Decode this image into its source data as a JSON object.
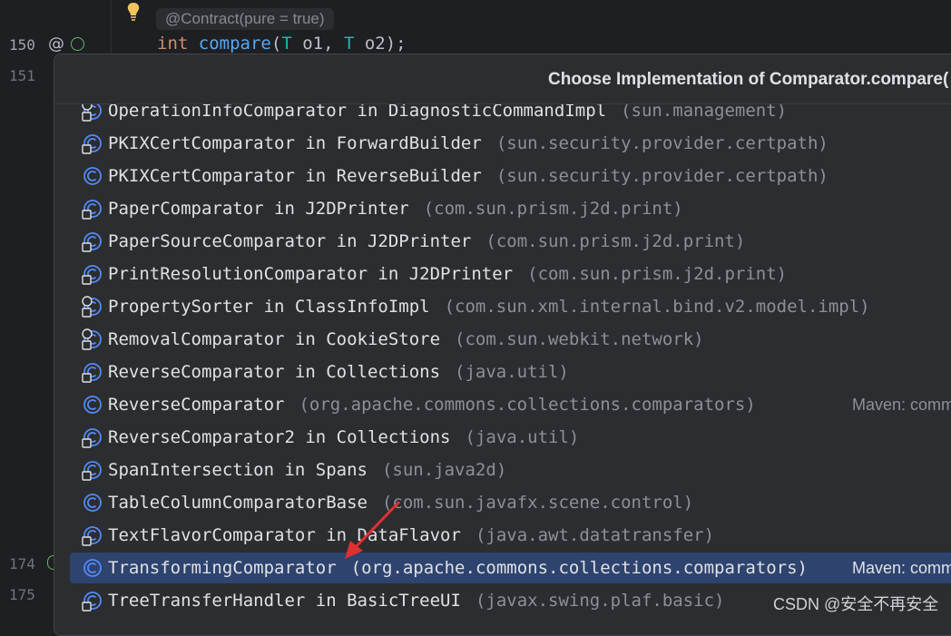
{
  "editor": {
    "annotation": "@Contract(pure = true)",
    "code": {
      "kw": "int",
      "fn": "compare",
      "rest1": "(",
      "t1": "T",
      "rest2": " o1, ",
      "t2": "T",
      "rest3": " o2);"
    },
    "line_numbers": [
      "150",
      "151",
      "174",
      "175"
    ]
  },
  "popup": {
    "title": "Choose Implementation of Comparator.compare(",
    "rows": [
      {
        "name": "OperationInfoComparator in DiagnosticCommandImpl",
        "pkg": "(sun.management)",
        "icon": "anonymous-class-icon",
        "extra": ""
      },
      {
        "name": "PKIXCertComparator in ForwardBuilder",
        "pkg": "(sun.security.provider.certpath)",
        "icon": "inner-class-icon",
        "extra": ""
      },
      {
        "name": "PKIXCertComparator in ReverseBuilder",
        "pkg": "(sun.security.provider.certpath)",
        "icon": "class-icon",
        "extra": ""
      },
      {
        "name": "PaperComparator in J2DPrinter",
        "pkg": "(com.sun.prism.j2d.print)",
        "icon": "inner-class-icon",
        "extra": ""
      },
      {
        "name": "PaperSourceComparator in J2DPrinter",
        "pkg": "(com.sun.prism.j2d.print)",
        "icon": "inner-class-icon",
        "extra": ""
      },
      {
        "name": "PrintResolutionComparator in J2DPrinter",
        "pkg": "(com.sun.prism.j2d.print)",
        "icon": "inner-class-icon",
        "extra": ""
      },
      {
        "name": "PropertySorter in ClassInfoImpl",
        "pkg": "(com.sun.xml.internal.bind.v2.model.impl)",
        "icon": "anonymous-class-icon",
        "extra": ""
      },
      {
        "name": "RemovalComparator in CookieStore",
        "pkg": "(com.sun.webkit.network)",
        "icon": "anonymous-class-icon",
        "extra": ""
      },
      {
        "name": "ReverseComparator in Collections",
        "pkg": "(java.util)",
        "icon": "inner-class-icon",
        "extra": ""
      },
      {
        "name": "ReverseComparator",
        "pkg": "(org.apache.commons.collections.comparators)",
        "icon": "class-icon",
        "extra": "Maven: comm"
      },
      {
        "name": "ReverseComparator2 in Collections",
        "pkg": "(java.util)",
        "icon": "inner-class-icon",
        "extra": ""
      },
      {
        "name": "SpanIntersection in Spans",
        "pkg": "(sun.java2d)",
        "icon": "inner-class-icon",
        "extra": ""
      },
      {
        "name": "TableColumnComparatorBase",
        "pkg": "(com.sun.javafx.scene.control)",
        "icon": "class-icon",
        "extra": ""
      },
      {
        "name": "TextFlavorComparator in DataFlavor",
        "pkg": "(java.awt.datatransfer)",
        "icon": "inner-class-icon",
        "extra": ""
      },
      {
        "name": "TransformingComparator",
        "pkg": "(org.apache.commons.collections.comparators)",
        "icon": "class-icon",
        "extra": "Maven: comm",
        "selected": true
      },
      {
        "name": "TreeTransferHandler in BasicTreeUI",
        "pkg": "(javax.swing.plaf.basic)",
        "icon": "inner-class-icon",
        "extra": ""
      }
    ]
  },
  "watermark": "CSDN @安全不再安全",
  "colors": {
    "selection": "#2e436e",
    "icon_blue": "#548af7",
    "arrow": "#e03030"
  }
}
